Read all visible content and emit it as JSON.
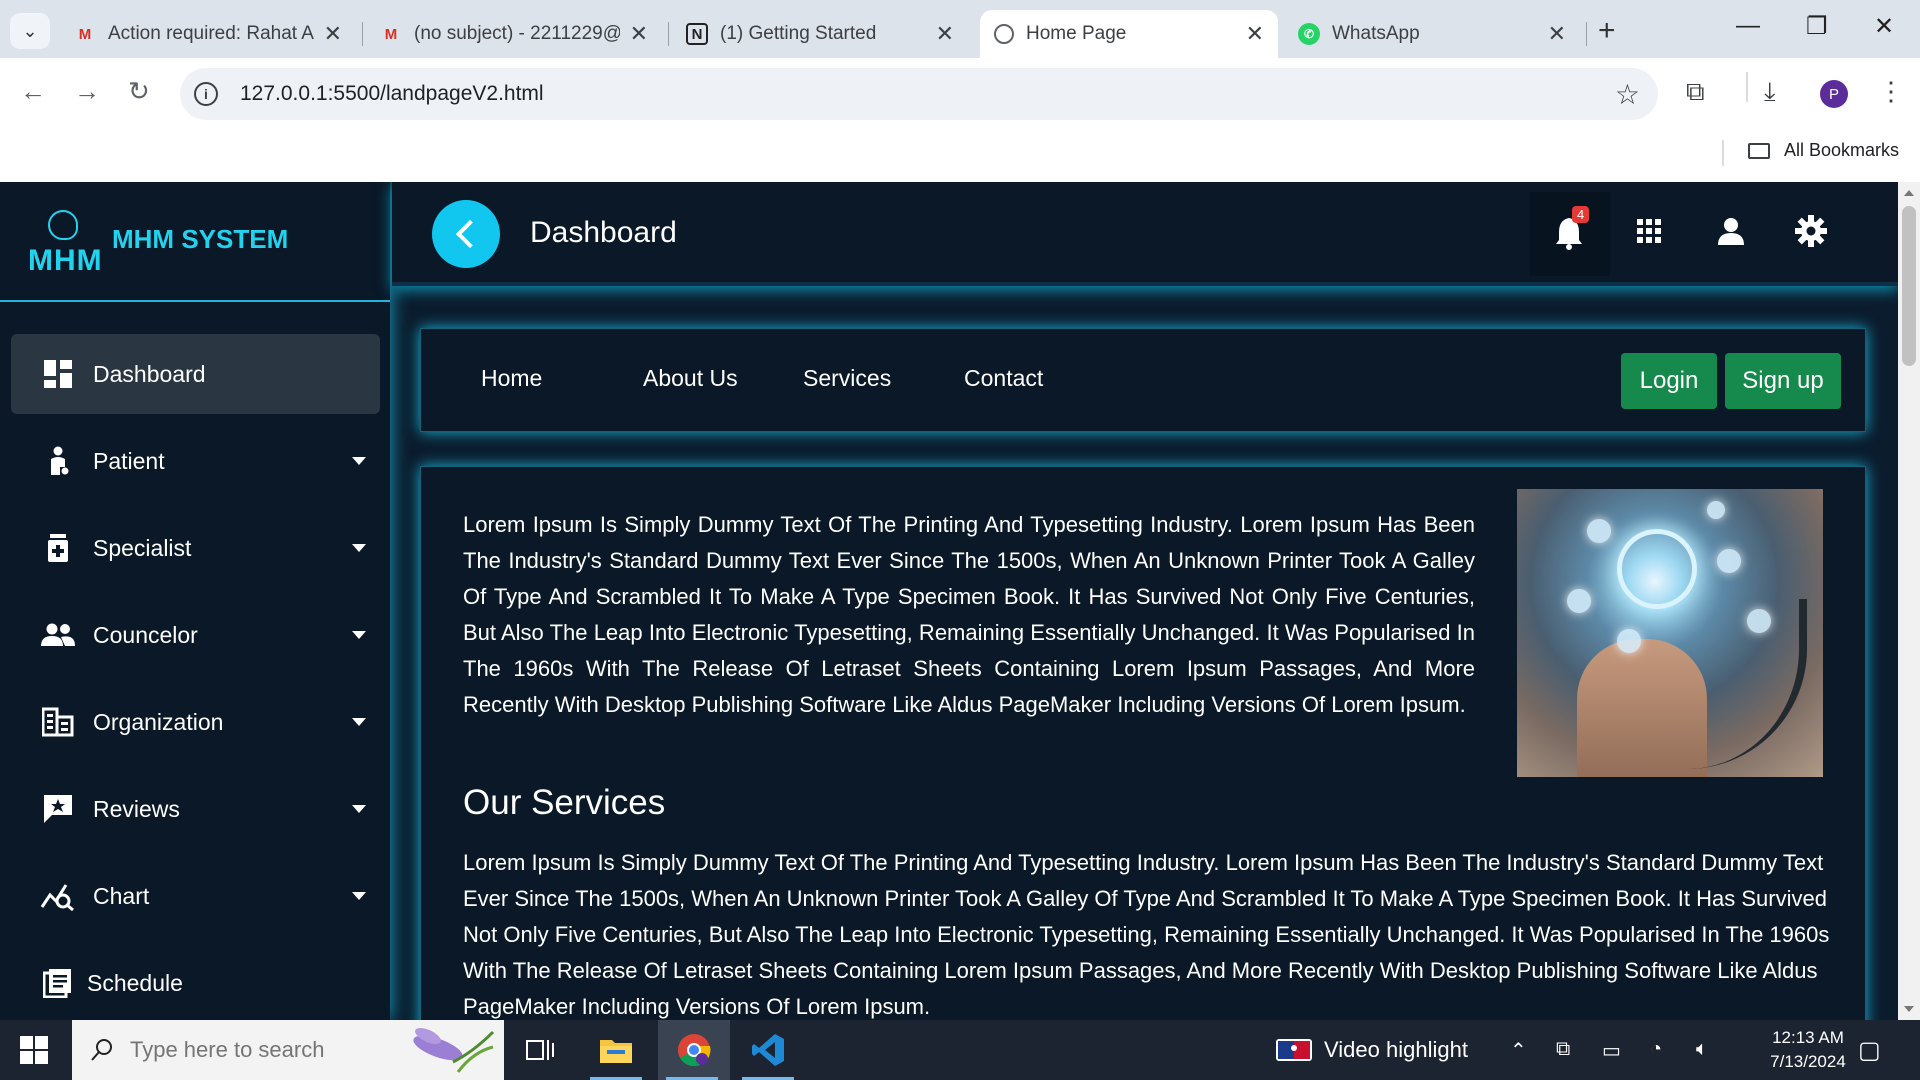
{
  "browser": {
    "tabs": [
      {
        "title": "Action required: Rahat Al",
        "favicon": "gmail-icon"
      },
      {
        "title": "(no subject) - 2211229@",
        "favicon": "gmail-icon"
      },
      {
        "title": "(1) Getting Started",
        "favicon": "notion-icon"
      },
      {
        "title": "Home Page",
        "favicon": "globe-icon",
        "active": true
      },
      {
        "title": "WhatsApp",
        "favicon": "whatsapp-icon"
      }
    ],
    "url": "127.0.0.1:5500/landpageV2.html",
    "all_bookmarks": "All Bookmarks",
    "profile_initial": "P"
  },
  "brand": {
    "logo_text": "MHM",
    "name": "MHM SYSTEM"
  },
  "sidebar": {
    "items": [
      {
        "label": "Dashboard",
        "icon": "dashboard-icon",
        "active": true
      },
      {
        "label": "Patient",
        "icon": "patient-icon",
        "dropdown": true
      },
      {
        "label": "Specialist",
        "icon": "specialist-icon",
        "dropdown": true
      },
      {
        "label": "Councelor",
        "icon": "councelor-icon",
        "dropdown": true
      },
      {
        "label": "Organization",
        "icon": "organization-icon",
        "dropdown": true
      },
      {
        "label": "Reviews",
        "icon": "reviews-icon",
        "dropdown": true
      },
      {
        "label": "Chart",
        "icon": "chart-icon",
        "dropdown": true
      },
      {
        "label": "Schedule",
        "icon": "schedule-icon"
      }
    ]
  },
  "topbar": {
    "title": "Dashboard",
    "notification_count": "4"
  },
  "nav": {
    "links": [
      "Home",
      "About Us",
      "Services",
      "Contact"
    ],
    "login": "Login",
    "signup": "Sign up"
  },
  "main": {
    "intro": "Lorem Ipsum Is Simply Dummy Text Of The Printing And Typesetting Industry. Lorem Ipsum Has Been The Industry's Standard Dummy Text Ever Since The 1500s, When An Unknown Printer Took A Galley Of Type And Scrambled It To Make A Type Specimen Book. It Has Survived Not Only Five Centuries, But Also The Leap Into Electronic Typesetting, Remaining Essentially Unchanged. It Was Popularised In The 1960s With The Release Of Letraset Sheets Containing Lorem Ipsum Passages, And More Recently With Desktop Publishing Software Like Aldus PageMaker Including Versions Of Lorem Ipsum.",
    "services_title": "Our Services",
    "services_text": "Lorem Ipsum Is Simply Dummy Text Of The Printing And Typesetting Industry. Lorem Ipsum Has Been The Industry's Standard Dummy Text Ever Since The 1500s, When An Unknown Printer Took A Galley Of Type And Scrambled It To Make A Type Specimen Book. It Has Survived Not Only Five Centuries, But Also The Leap Into Electronic Typesetting, Remaining Essentially Unchanged. It Was Popularised In The 1960s With The Release Of Letraset Sheets Containing Lorem Ipsum Passages, And More Recently With Desktop Publishing Software Like Aldus PageMaker Including Versions Of Lorem Ipsum."
  },
  "taskbar": {
    "search_placeholder": "Type here to search",
    "video_highlight": "Video highlight",
    "time": "12:13 AM",
    "date": "7/13/2024"
  },
  "colors": {
    "accent": "#11c7ef",
    "brand": "#22d3ee",
    "button_green": "#168a4c",
    "page_bg": "#0b1c2d"
  }
}
